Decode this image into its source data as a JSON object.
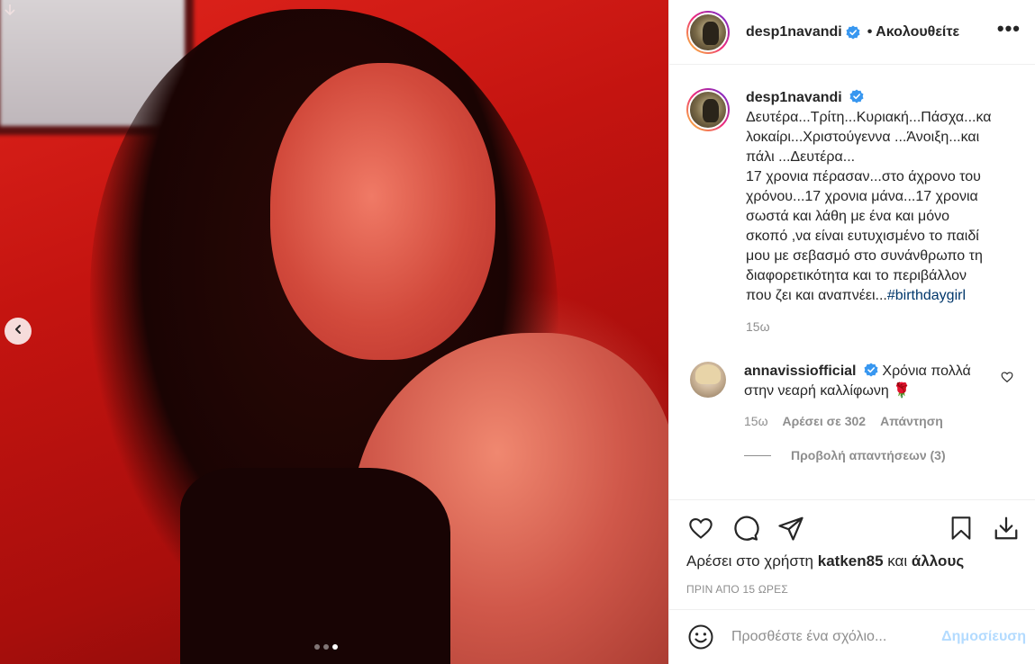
{
  "post": {
    "carousel_dots": [
      false,
      false,
      true
    ]
  },
  "header": {
    "username": "desp1navandi",
    "follow_status": "• Ακολουθείτε",
    "more": "•••"
  },
  "caption": {
    "username": "desp1navandi",
    "lines": [
      "Δευτέρα...Τρίτη...Κυριακή...Πάσχα...κα",
      "λοκαίρι...Χριστούγεννα ...Άνοιξη...και",
      "πάλι ...Δευτέρα...",
      "17 χρονια πέρασαν...στο άχρονο του",
      "χρόνου...17 χρονια μάνα...17 χρονια",
      "σωστά και λάθη με ένα και μόνο",
      "σκοπό ,να είναι ευτυχισμένο το παιδί",
      "μου με σεβασμό στο συνάνθρωπο τη",
      "διαφορετικότητα και το περιβάλλον",
      "που ζει και αναπνέει..."
    ],
    "hashtag": "#birthdaygirl",
    "time": "15ω"
  },
  "comment": {
    "username": "annavissiofficial",
    "text_line1": "Χρόνια πολλά",
    "text_line2": "στην νεαρή καλλίφωνη 🌹",
    "time": "15ω",
    "likes": "Αρέσει σε 302",
    "reply": "Απάντηση",
    "view_replies": "Προβολή απαντήσεων (3)"
  },
  "likes": {
    "prefix": "Αρέσει στο χρήστη",
    "user": "katken85",
    "middle": "και",
    "others": "άλλους"
  },
  "timestamp": "ΠΡΙΝ ΑΠΟ 15 ΩΡΕΣ",
  "add_comment": {
    "placeholder": "Προσθέστε ένα σχόλιο...",
    "post_label": "Δημοσίευση"
  },
  "colors": {
    "text": "#262626",
    "secondary": "#8e8e8e",
    "verified": "#3897f0",
    "link": "#00376b",
    "post_disabled": "#b3dbff"
  },
  "icons": [
    "heart-icon",
    "comment-icon",
    "share-icon",
    "bookmark-icon",
    "download-icon",
    "emoji-icon",
    "verified-icon",
    "chevron-left-icon"
  ]
}
